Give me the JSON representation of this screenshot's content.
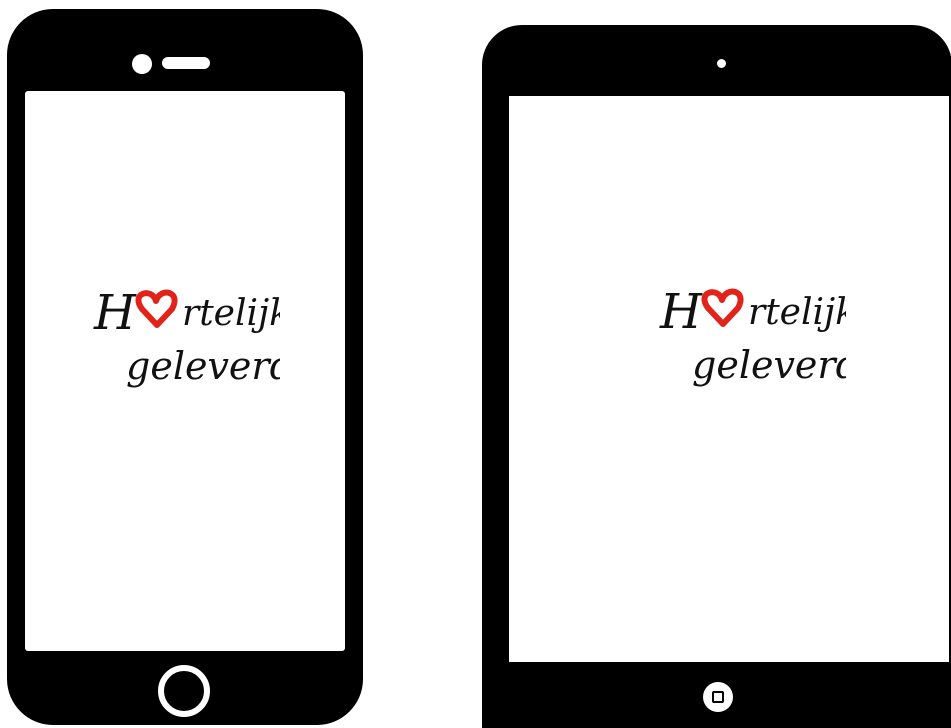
{
  "devices": [
    {
      "type": "smartphone"
    },
    {
      "type": "tablet"
    }
  ],
  "logo": {
    "line1_start": "H",
    "line1_rest": "rtelijk",
    "line2": "geleverd!",
    "heart_color": "#e2231a",
    "text_color": "#111111"
  }
}
